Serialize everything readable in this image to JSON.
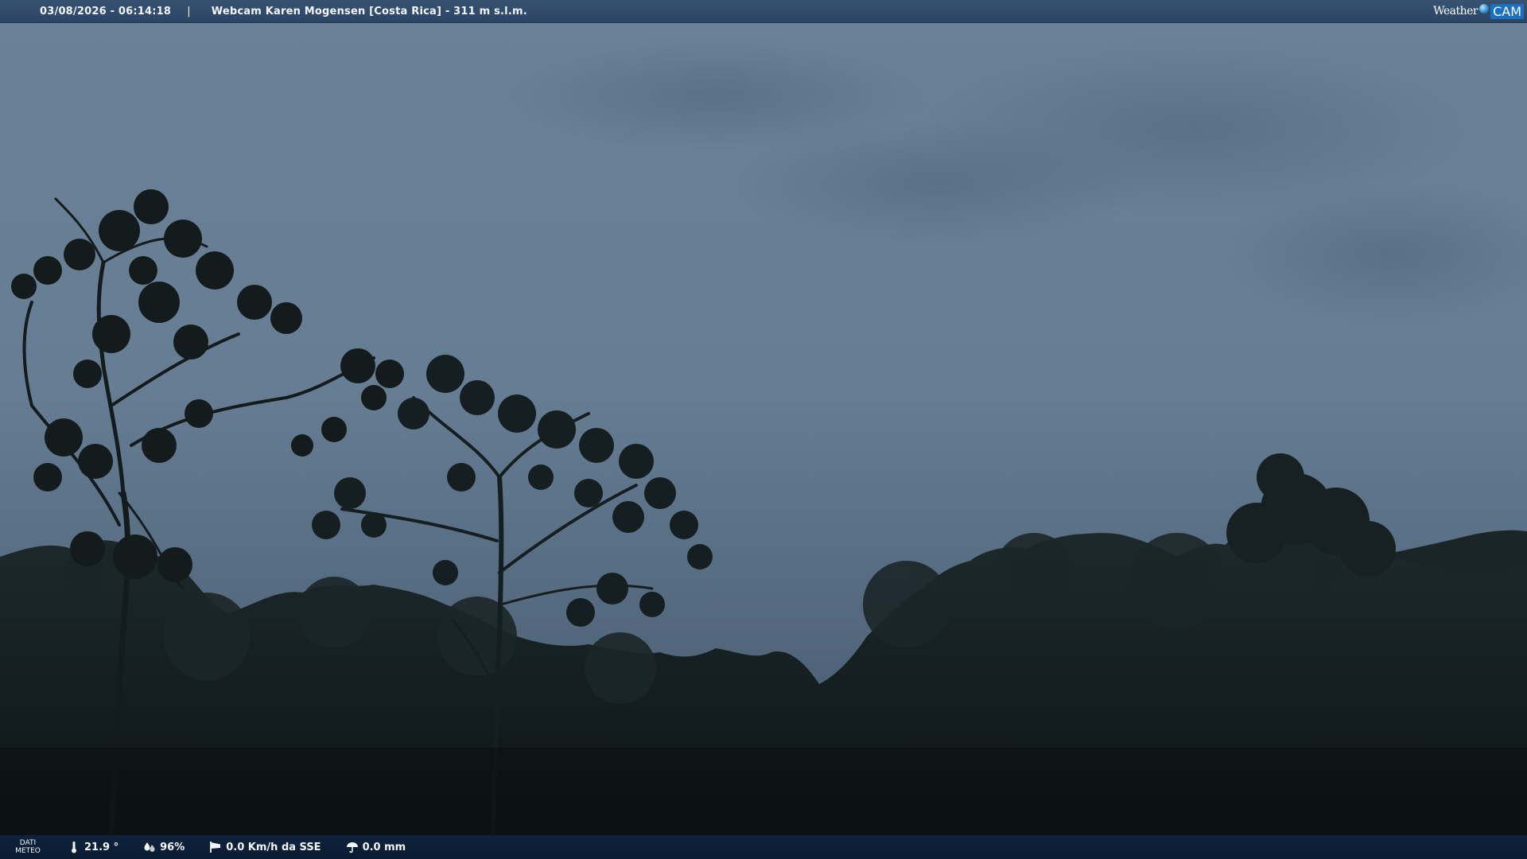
{
  "header": {
    "timestamp": "03/08/2026 - 06:14:18",
    "separator": "|",
    "title": "Webcam Karen Mogensen [Costa Rica]  - 311 m s.l.m."
  },
  "brand": {
    "word": "Weather",
    "suffix": "CAM"
  },
  "footer": {
    "label_line1": "DATI",
    "label_line2": "METEO",
    "temperature": "21.9 °",
    "humidity": "96%",
    "wind": "0.0 Km/h da SSE",
    "rain": "0.0 mm"
  },
  "icons": {
    "temperature": "thermometer-icon",
    "humidity": "humidity-drops-icon",
    "wind": "windsock-icon",
    "rain": "umbrella-icon"
  },
  "colors": {
    "sky_top": "#6e8399",
    "sky_bottom": "#4a5f74",
    "vegetation": "#141d20",
    "header_bg": "#344e6e",
    "footer_bg": "#0e243e",
    "text": "#f2f5f8"
  }
}
